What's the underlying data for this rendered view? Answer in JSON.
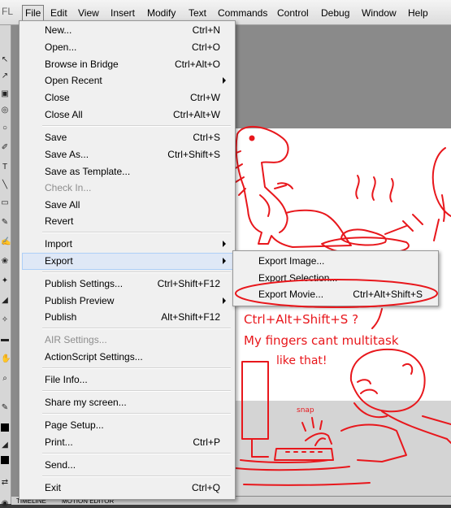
{
  "app": {
    "logo": "FL"
  },
  "menubar": [
    {
      "label": "File",
      "active": true
    },
    {
      "label": "Edit"
    },
    {
      "label": "View"
    },
    {
      "label": "Insert"
    },
    {
      "label": "Modify"
    },
    {
      "label": "Text"
    },
    {
      "label": "Commands"
    },
    {
      "label": "Control"
    },
    {
      "label": "Debug"
    },
    {
      "label": "Window"
    },
    {
      "label": "Help"
    }
  ],
  "file_menu": {
    "items": [
      {
        "label": "New...",
        "shortcut": "Ctrl+N"
      },
      {
        "label": "Open...",
        "shortcut": "Ctrl+O"
      },
      {
        "label": "Browse in Bridge",
        "shortcut": "Ctrl+Alt+O"
      },
      {
        "label": "Open Recent",
        "submenu": true
      },
      {
        "label": "Close",
        "shortcut": "Ctrl+W"
      },
      {
        "label": "Close All",
        "shortcut": "Ctrl+Alt+W"
      },
      {
        "label": "Save",
        "shortcut": "Ctrl+S"
      },
      {
        "label": "Save As...",
        "shortcut": "Ctrl+Shift+S"
      },
      {
        "label": "Save as Template..."
      },
      {
        "label": "Check In...",
        "disabled": true
      },
      {
        "label": "Save All"
      },
      {
        "label": "Revert"
      },
      {
        "label": "Import",
        "submenu": true
      },
      {
        "label": "Export",
        "submenu": true,
        "highlighted": true
      },
      {
        "label": "Publish Settings...",
        "shortcut": "Ctrl+Shift+F12"
      },
      {
        "label": "Publish Preview",
        "submenu": true
      },
      {
        "label": "Publish",
        "shortcut": "Alt+Shift+F12"
      },
      {
        "label": "AIR Settings...",
        "disabled": true
      },
      {
        "label": "ActionScript Settings..."
      },
      {
        "label": "File Info..."
      },
      {
        "label": "Share my screen..."
      },
      {
        "label": "Page Setup..."
      },
      {
        "label": "Print...",
        "shortcut": "Ctrl+P"
      },
      {
        "label": "Send..."
      },
      {
        "label": "Exit",
        "shortcut": "Ctrl+Q"
      }
    ]
  },
  "export_submenu": {
    "items": [
      {
        "label": "Export Image..."
      },
      {
        "label": "Export Selection..."
      },
      {
        "label": "Export Movie...",
        "shortcut": "Ctrl+Alt+Shift+S"
      }
    ]
  },
  "bottom_tabs": [
    "TIMELINE",
    "MOTION EDITOR"
  ],
  "annotation": {
    "line1": "Ctrl+Alt+Shift+S ?",
    "line2": "My fingers cant multitask",
    "line3": "like that!",
    "sound": "snap",
    "color": "#e8171c"
  },
  "colors": {
    "menu_bg": "#f0f0f0",
    "highlight": "#dfe8f6",
    "ink": "#e8171c"
  }
}
